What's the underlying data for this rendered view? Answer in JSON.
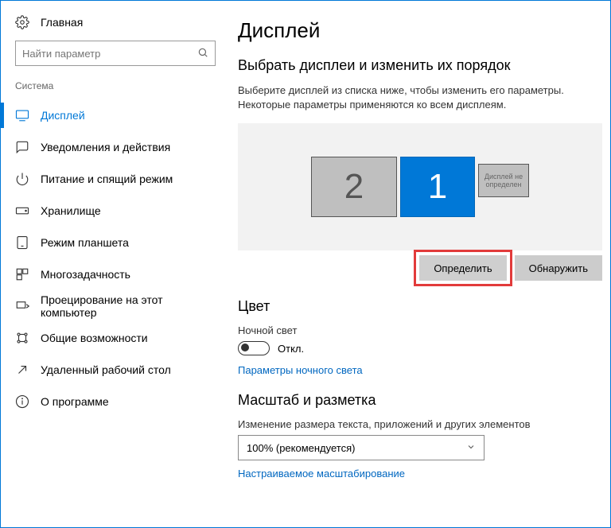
{
  "sidebar": {
    "home": "Главная",
    "search_placeholder": "Найти параметр",
    "section": "Система",
    "items": [
      {
        "label": "Дисплей"
      },
      {
        "label": "Уведомления и действия"
      },
      {
        "label": "Питание и спящий режим"
      },
      {
        "label": "Хранилище"
      },
      {
        "label": "Режим планшета"
      },
      {
        "label": "Многозадачность"
      },
      {
        "label": "Проецирование на этот компьютер"
      },
      {
        "label": "Общие возможности"
      },
      {
        "label": "Удаленный рабочий стол"
      },
      {
        "label": "О программе"
      }
    ]
  },
  "main": {
    "title": "Дисплей",
    "arrange_heading": "Выбрать дисплеи и изменить их порядок",
    "arrange_desc": "Выберите дисплей из списка ниже, чтобы изменить его параметры. Некоторые параметры применяются ко всем дисплеям.",
    "monitor2": "2",
    "monitor1": "1",
    "monitor_unknown": "Дисплей не определен",
    "identify_btn": "Определить",
    "detect_btn": "Обнаружить",
    "color_heading": "Цвет",
    "night_light_label": "Ночной свет",
    "toggle_state": "Откл.",
    "night_light_link": "Параметры ночного света",
    "scale_heading": "Масштаб и разметка",
    "scale_label": "Изменение размера текста, приложений и других элементов",
    "scale_value": "100% (рекомендуется)",
    "custom_scale_link": "Настраиваемое масштабирование"
  }
}
